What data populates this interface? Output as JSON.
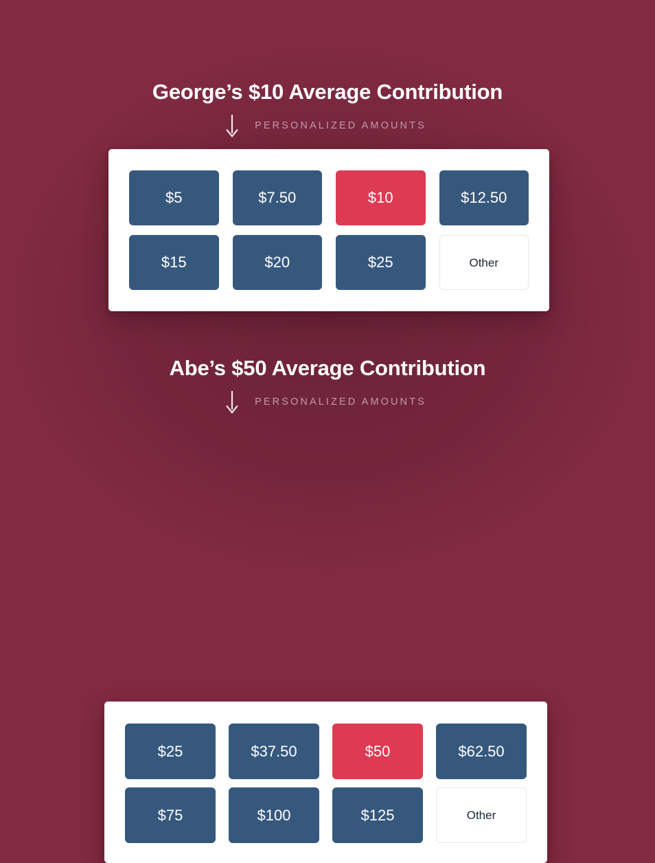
{
  "theme": {
    "background_color": "#812a42",
    "card_background": "#ffffff",
    "primary_button_color": "#36587d",
    "selected_button_color": "#dc3b53",
    "other_button_border": "#e3e8ef",
    "other_button_text": "#1c2536",
    "title_color": "#ffffff",
    "subhead_color": "#c39aa8",
    "arrow_color": "#ffffff"
  },
  "sections": [
    {
      "id": "george",
      "title": "George’s $10 Average Contribution",
      "donor_name": "George",
      "average_contribution": "$10",
      "subhead": "PERSONALIZED AMOUNTS",
      "arrow_icon": "arrow-down-icon",
      "amounts": [
        {
          "label": "$5",
          "state": "default",
          "style": "style-primary"
        },
        {
          "label": "$7.50",
          "state": "default",
          "style": "style-primary"
        },
        {
          "label": "$10",
          "state": "selected",
          "style": "style-selected"
        },
        {
          "label": "$12.50",
          "state": "default",
          "style": "style-primary"
        },
        {
          "label": "$15",
          "state": "default",
          "style": "style-primary"
        },
        {
          "label": "$20",
          "state": "default",
          "style": "style-primary"
        },
        {
          "label": "$25",
          "state": "default",
          "style": "style-primary"
        },
        {
          "label": "Other",
          "state": "other",
          "style": "style-other"
        }
      ]
    },
    {
      "id": "abe",
      "title": "Abe’s $50 Average Contribution",
      "donor_name": "Abe",
      "average_contribution": "$50",
      "subhead": "PERSONALIZED AMOUNTS",
      "arrow_icon": "arrow-down-icon",
      "amounts": [
        {
          "label": "$25",
          "state": "default",
          "style": "style-primary"
        },
        {
          "label": "$37.50",
          "state": "default",
          "style": "style-primary"
        },
        {
          "label": "$50",
          "state": "selected",
          "style": "style-selected"
        },
        {
          "label": "$62.50",
          "state": "default",
          "style": "style-primary"
        },
        {
          "label": "$75",
          "state": "default",
          "style": "style-primary"
        },
        {
          "label": "$100",
          "state": "default",
          "style": "style-primary"
        },
        {
          "label": "$125",
          "state": "default",
          "style": "style-primary"
        },
        {
          "label": "Other",
          "state": "other",
          "style": "style-other"
        }
      ]
    }
  ]
}
